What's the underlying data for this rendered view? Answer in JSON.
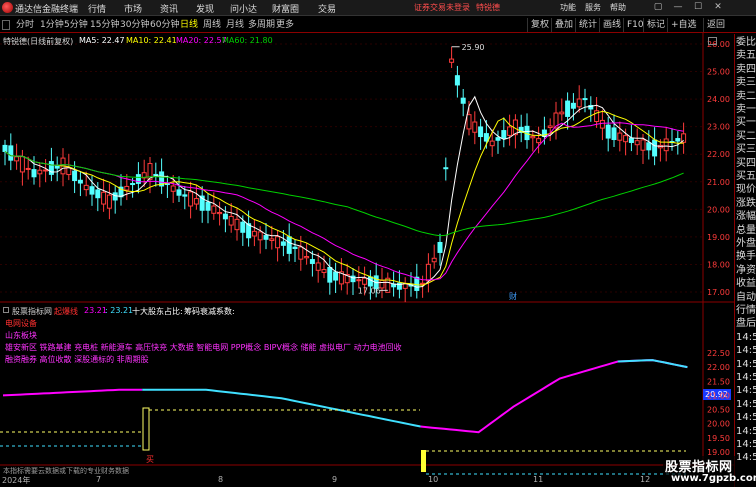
{
  "menubar": {
    "app_title": "通达信金融终端",
    "items": [
      "行情",
      "市场",
      "资讯",
      "发现",
      "问小达",
      "财富圈",
      "交易"
    ],
    "notice": "证券交易未登录",
    "notice2": "特锐德",
    "right": [
      "功能",
      "服务",
      "帮助"
    ],
    "win": [
      "▢",
      "—",
      "☐",
      "✕"
    ]
  },
  "toolbar": {
    "periods": [
      "分时",
      "1分钟",
      "5分钟",
      "15分钟",
      "30分钟",
      "60分钟",
      "日线",
      "周线",
      "月线",
      "多周期",
      "更多"
    ],
    "active_period": "日线",
    "right_buttons": [
      "复权",
      "叠加",
      "统计",
      "画线",
      "F10",
      "标记",
      "+自选",
      "返回"
    ]
  },
  "chart_header": {
    "stock": "特锐德(日线前复权)",
    "ma5_label": "MA5: 22.47",
    "ma10_label": "MA10: 22.41",
    "ma20_label": "MA20: 22.57",
    "ma60_label": "MA60: 21.80"
  },
  "indicator_header": {
    "source": "股票指标网",
    "name": "起爆线",
    "v1": "23.21",
    "v2": ": 23.21",
    "v3": "十大股东占比:",
    "v4": "筹码衰减系数:"
  },
  "concepts": {
    "line1": "电网设备",
    "line2": "山东板块",
    "line3": "雄安新区 铁路基建 充电桩 新能源车 高压快充 大数据 智能电网 PPP概念 BIPV概念 储能 虚拟电厂 动力电池回收",
    "line4": "融资融券 高位收散 深股通标的 非周期股"
  },
  "annotations": {
    "high_price": "25.90",
    "low_price": "17.06",
    "finance_marker": "财",
    "buy_label": "买",
    "indicator_value": "20.92"
  },
  "axes": {
    "price_ticks": [
      "26.00",
      "25.00",
      "24.00",
      "23.00",
      "22.00",
      "21.00",
      "20.00",
      "19.00",
      "18.00",
      "17.00"
    ],
    "indicator_ticks": [
      "22.50",
      "22.00",
      "21.50",
      "21.00",
      "20.50",
      "20.00",
      "19.50",
      "19.00"
    ],
    "x_labels": [
      {
        "label": "2024年"
      },
      {
        "label": "7"
      },
      {
        "label": "8"
      },
      {
        "label": "9"
      },
      {
        "label": "10"
      },
      {
        "label": "11"
      },
      {
        "label": "12"
      }
    ]
  },
  "right_panel": [
    "委比",
    "卖五",
    "卖四",
    "卖三",
    "卖二",
    "卖一",
    "买一",
    "买二",
    "买三",
    "买四",
    "买五",
    "现价",
    "涨跌",
    "涨幅",
    "总量",
    "外盘",
    "换手",
    "净资",
    "收益",
    "自动",
    "行情",
    "盘后",
    "14:5",
    "14:5",
    "14:5",
    "14:5",
    "14:5",
    "14:5",
    "14:5",
    "14:5",
    "14:5",
    "14:5"
  ],
  "bottom_note": "本指标需要云数据或下载的专业财务数据",
  "watermark": {
    "line1": "股票指标网",
    "line2": "www.7gpzb.com"
  },
  "colors": {
    "up": "#ff3b3b",
    "down": "#54ffff",
    "ma5": "#ffffff",
    "ma10": "#ffff00",
    "ma20": "#ff00ff",
    "ma60": "#00d000",
    "indicator_up": "#ff00ff",
    "indicator_down": "#40e0ff",
    "concept_text": "#ff33ff",
    "concept_red": "#ff3030"
  }
}
